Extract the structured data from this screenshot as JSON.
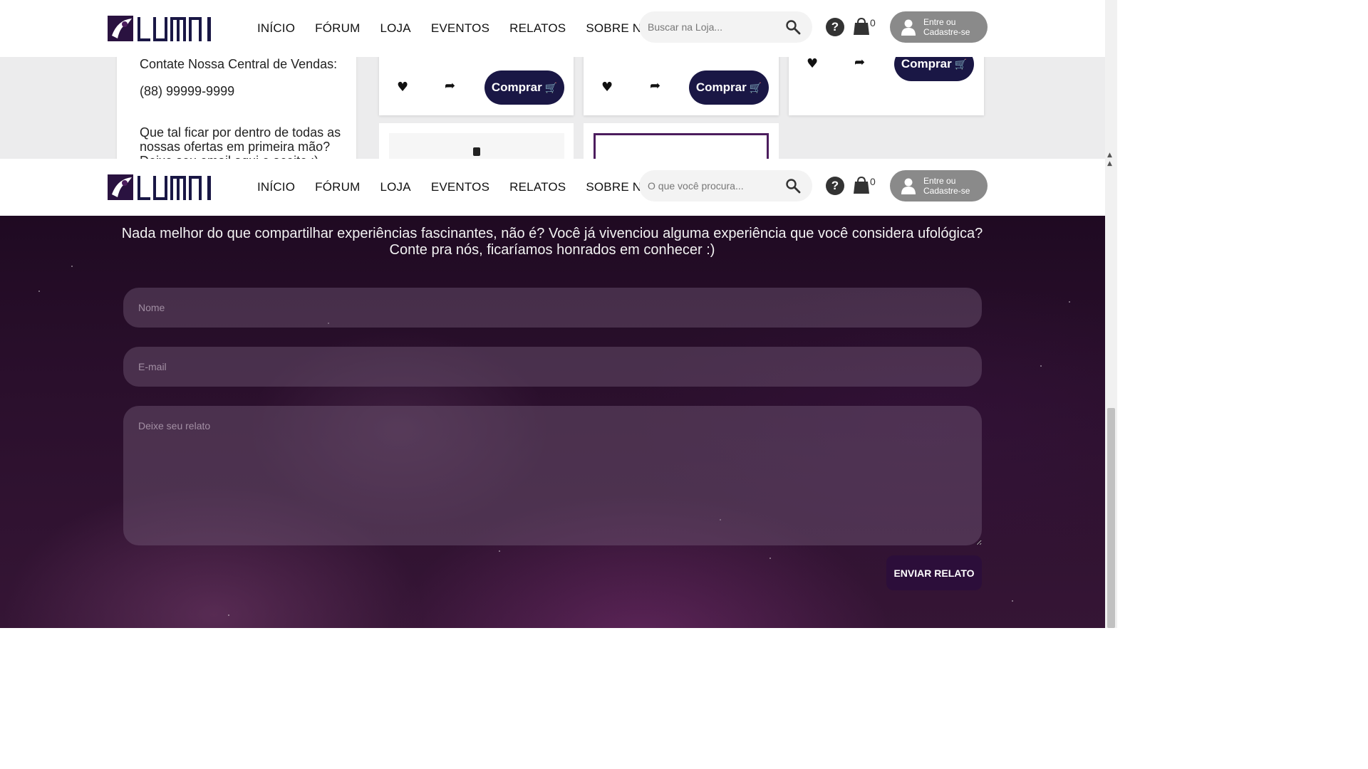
{
  "brand": {
    "logo_text": "LUMNI",
    "accent": "#1a1745",
    "purple": "#4c1d5e"
  },
  "nav": {
    "items": [
      "INÍCIO",
      "FÓRUM",
      "LOJA",
      "EVENTOS",
      "RELATOS",
      "SOBRE NÓS"
    ]
  },
  "header_top": {
    "search_placeholder": "Buscar na Loja...",
    "cart_count": "0",
    "login_label_line1": "Entre ou",
    "login_label_line2": "Cadastre-se"
  },
  "header_bottom": {
    "search_placeholder": "O que você procura...",
    "cart_count": "0",
    "login_label_line1": "Entre ou",
    "login_label_line2": "Cadastre-se"
  },
  "sidebar": {
    "contact_label": "Contate Nossa Central de Vendas:",
    "phone": "(88) 99999-9999",
    "promo_text": "Que tal ficar por dentro de todas as nossas ofertas em primeira mão? Deixe seu email aqui e aceite :)"
  },
  "products": {
    "buy_label": "Comprar"
  },
  "report": {
    "intro": "Nada melhor do que compartilhar experiências fascinantes, não é? Você já vivenciou alguma experiência que você considera ufológica? Conte pra nós, ficaríamos honrados em conhecer :)",
    "name_placeholder": "Nome",
    "email_placeholder": "E-mail",
    "message_placeholder": "Deixe seu relato",
    "submit_label": "ENVIAR RELATO"
  }
}
